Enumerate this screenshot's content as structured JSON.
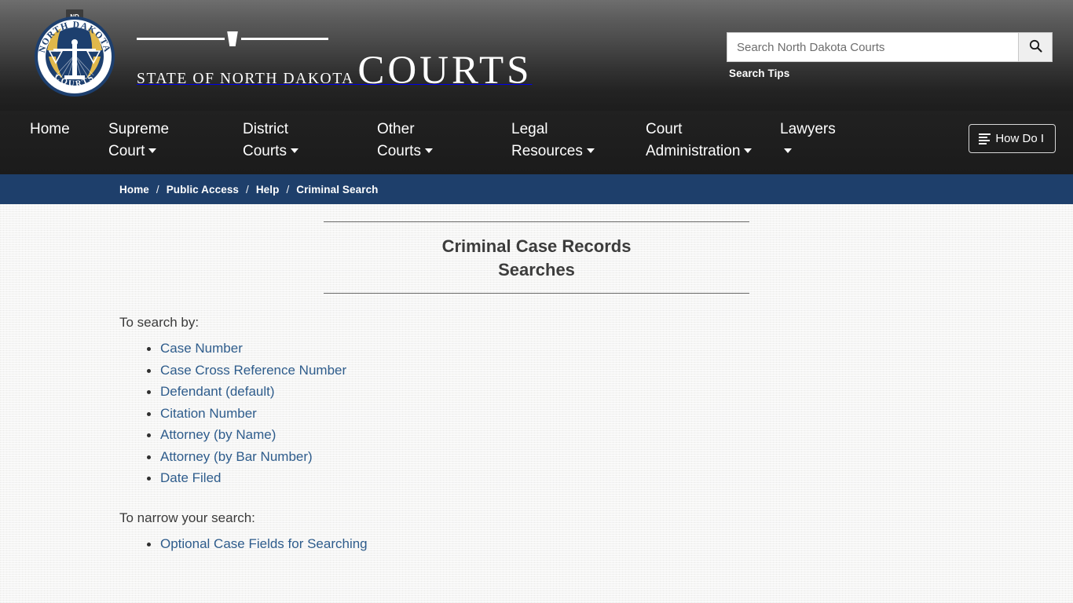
{
  "header": {
    "seal": {
      "top_label": "ND",
      "arc_top": "NORTH DAKOTA",
      "arc_bottom": "COURTS"
    },
    "wordmark": {
      "state_line": "STATE OF NORTH DAKOTA",
      "courts_line": "COURTS"
    }
  },
  "search": {
    "placeholder": "Search North Dakota Courts",
    "value": "",
    "button_icon": "search-icon",
    "tips_label": "Search Tips"
  },
  "nav": {
    "items": [
      {
        "label": "Home",
        "line2": "",
        "caret": false
      },
      {
        "label": "Supreme",
        "line2": "Court",
        "caret": true
      },
      {
        "label": "District",
        "line2": "Courts",
        "caret": true
      },
      {
        "label": "Other",
        "line2": "Courts",
        "caret": true
      },
      {
        "label": "Legal",
        "line2": "Resources",
        "caret": true
      },
      {
        "label": "Court",
        "line2": "Administration",
        "caret": true
      },
      {
        "label": "Lawyers",
        "line2": "",
        "caret": true
      }
    ],
    "how_do_i_label": "How Do I"
  },
  "breadcrumb": {
    "separator": "/",
    "items": [
      {
        "label": "Home",
        "current": false
      },
      {
        "label": "Public Access",
        "current": false
      },
      {
        "label": "Help",
        "current": false
      },
      {
        "label": "Criminal Search",
        "current": true
      }
    ]
  },
  "main": {
    "title_line1": "Criminal Case Records",
    "title_line2": "Searches",
    "search_by_heading": "To search by:",
    "search_by_links": [
      "Case Number",
      "Case Cross Reference Number",
      "Defendant (default)",
      "Citation Number",
      "Attorney (by Name)",
      "Attorney (by Bar Number)",
      "Date Filed"
    ],
    "narrow_heading": "To narrow your search:",
    "narrow_links": [
      "Optional Case Fields for Searching"
    ]
  },
  "colors": {
    "breadcrumb_bar": "#1e3f6b",
    "link": "#2e5c8c",
    "nav_bg": "#1d1d1d",
    "page_bg": "#f1f1ef",
    "seal_blue": "#1d3f6e",
    "seal_gold": "#e0b84b"
  }
}
